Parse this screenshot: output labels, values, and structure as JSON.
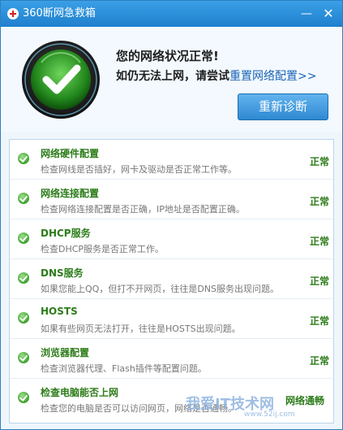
{
  "window": {
    "title": "360断网急救箱"
  },
  "controls": {
    "minimize": "—",
    "close": "✕"
  },
  "status": {
    "title": "您的网络状况正常!",
    "hint_prefix": "如仍无法上网，请尝试",
    "reset_link": "重置网络配置>>",
    "icon": "check-icon"
  },
  "actions": {
    "rediagnose": "重新诊断"
  },
  "items": [
    {
      "name": "网络硬件配置",
      "desc": "检查网线是否插好，网卡及驱动是否正常工作等。",
      "status": "正常"
    },
    {
      "name": "网络连接配置",
      "desc": "检查网络连接配置是否正确，IP地址是否配置正确。",
      "status": "正常"
    },
    {
      "name": "DHCP服务",
      "desc": "检查DHCP服务是否正常工作。",
      "status": "正常"
    },
    {
      "name": "DNS服务",
      "desc": "如果您能上QQ，但打不开网页，往往是DNS服务出现问题。",
      "status": "正常"
    },
    {
      "name": "HOSTS",
      "desc": "如果有些网页无法打开，往往是HOSTS出现问题。",
      "status": "正常"
    },
    {
      "name": "浏览器配置",
      "desc": "检查浏览器代理、Flash插件等配置问题。",
      "status": "正常"
    },
    {
      "name": "检查电脑能否上网",
      "desc": "检查您的电脑是否可以访问网页，网络是否通畅。",
      "status": "网络通畅"
    }
  ],
  "watermark": {
    "text": "我爱IT技术网",
    "sub": "www.52ij.com"
  },
  "colors": {
    "titlebar": "#2a8ad8",
    "ok_green": "#2c7c19",
    "link": "#1a63b5",
    "button": "#3a92d6"
  }
}
